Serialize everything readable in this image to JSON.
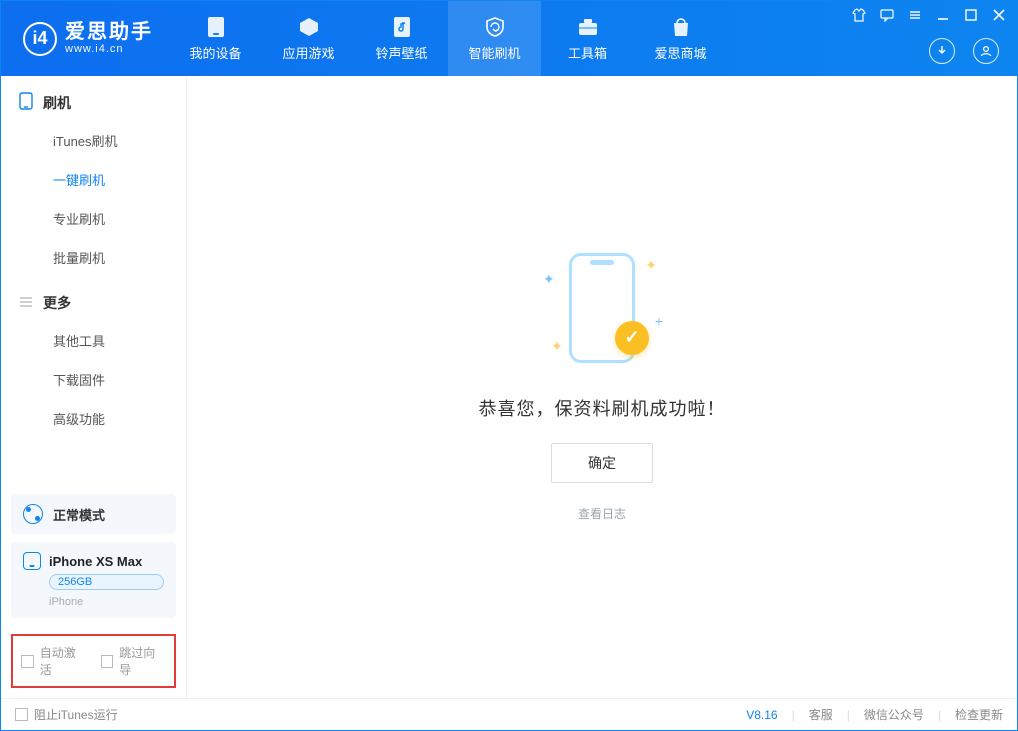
{
  "app": {
    "name": "爱思助手",
    "url": "www.i4.cn"
  },
  "header_tabs": [
    {
      "label": "我的设备"
    },
    {
      "label": "应用游戏"
    },
    {
      "label": "铃声壁纸"
    },
    {
      "label": "智能刷机"
    },
    {
      "label": "工具箱"
    },
    {
      "label": "爱思商城"
    }
  ],
  "sidebar": {
    "section1": {
      "title": "刷机",
      "items": [
        "iTunes刷机",
        "一键刷机",
        "专业刷机",
        "批量刷机"
      ],
      "active_index": 1
    },
    "section2": {
      "title": "更多",
      "items": [
        "其他工具",
        "下载固件",
        "高级功能"
      ]
    },
    "mode_label": "正常模式",
    "device": {
      "name": "iPhone XS Max",
      "capacity": "256GB",
      "subtitle": "iPhone"
    },
    "checkboxes": {
      "auto_activate": "自动激活",
      "skip_guide": "跳过向导"
    }
  },
  "main": {
    "success_message": "恭喜您，保资料刷机成功啦！",
    "confirm_label": "确定",
    "log_link": "查看日志"
  },
  "footer": {
    "block_itunes": "阻止iTunes运行",
    "version": "V8.16",
    "links": [
      "客服",
      "微信公众号",
      "检查更新"
    ]
  }
}
